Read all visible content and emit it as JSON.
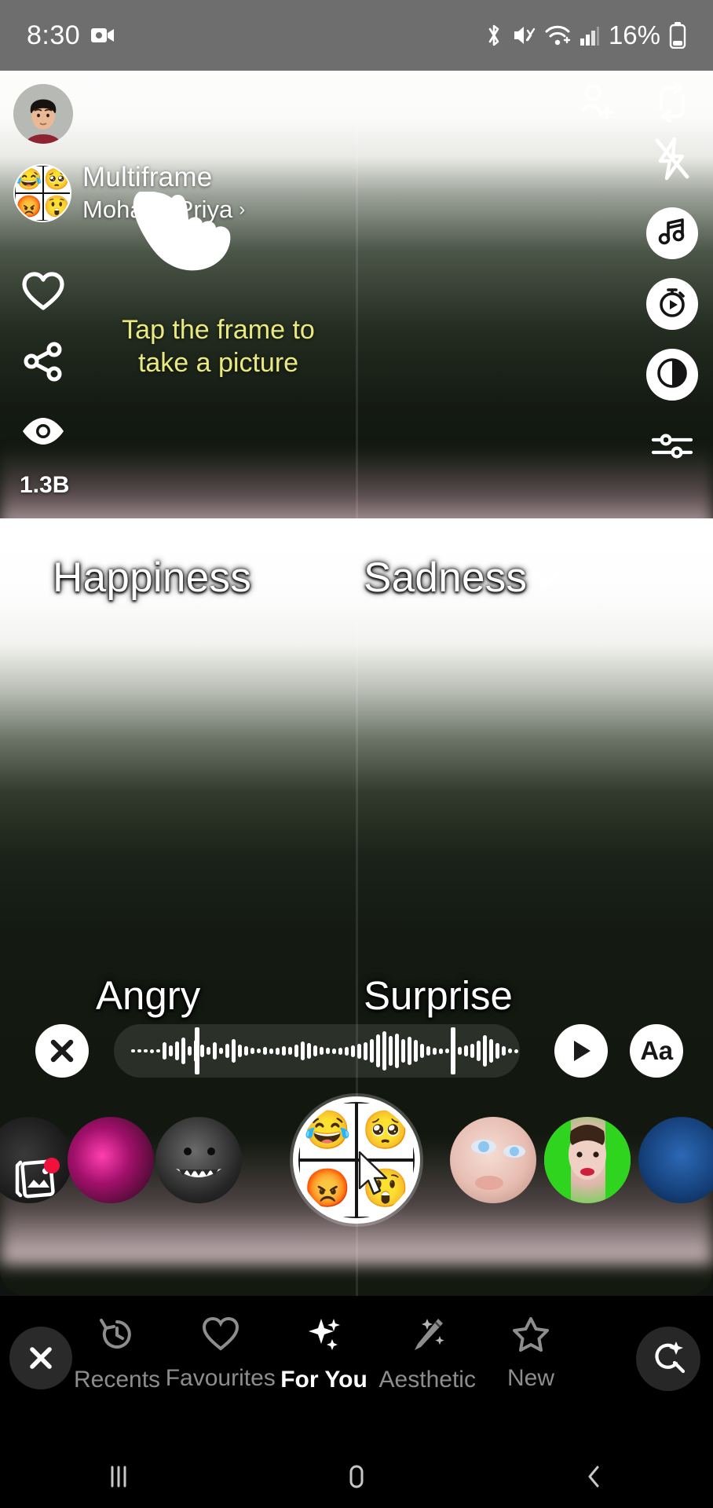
{
  "status_bar": {
    "time": "8:30",
    "battery_percent": "16%",
    "icons": [
      "screen-record-icon",
      "bluetooth-icon",
      "mute-icon",
      "wifi-icon",
      "cellular-signal-icon",
      "battery-icon"
    ]
  },
  "lens": {
    "title": "Multiframe",
    "author": "Mohana Priya",
    "author_chevron": "›",
    "quad_emojis": [
      "😂",
      "🥺",
      "😡",
      "😲"
    ],
    "favorite_count": "1.3B",
    "hint_line1": "Tap the frame to",
    "hint_line2": "take a picture",
    "hint_color": "#e9e97f"
  },
  "left_rail": [
    {
      "name": "heart-icon",
      "label": "Favourite"
    },
    {
      "name": "share-icon",
      "label": "Share"
    },
    {
      "name": "eye-icon",
      "label": "Preview"
    }
  ],
  "right_rail": [
    {
      "name": "add-person-icon",
      "label": "Add friend"
    },
    {
      "name": "flip-camera-icon",
      "label": "Flip camera"
    },
    {
      "name": "flash-off-icon",
      "label": "Flash off"
    },
    {
      "name": "music-icon",
      "label": "Music"
    },
    {
      "name": "timer-icon",
      "label": "Timer"
    },
    {
      "name": "contrast-icon",
      "label": "Contrast"
    },
    {
      "name": "adjust-sliders-icon",
      "label": "Adjust"
    }
  ],
  "frames": {
    "top_left_label": "Happiness",
    "top_right_label": "Sadness",
    "top_right_chevron": "⌄",
    "bottom_left_label": "Angry",
    "bottom_right_label": "Surprise"
  },
  "audio_bar": {
    "close_label": "✕",
    "play_label": "▶",
    "text_label": "Aa",
    "waveform": [
      3,
      4,
      4,
      5,
      3,
      22,
      14,
      24,
      34,
      12,
      28,
      16,
      10,
      22,
      8,
      18,
      30,
      16,
      12,
      8,
      6,
      10,
      7,
      9,
      12,
      10,
      16,
      24,
      20,
      14,
      10,
      8,
      7,
      9,
      11,
      15,
      19,
      23,
      30,
      42,
      50,
      38,
      44,
      30,
      36,
      28,
      18,
      12,
      9,
      7,
      6,
      8,
      10,
      14,
      18,
      26,
      40,
      30,
      20,
      12,
      6,
      5,
      4,
      5,
      4,
      3
    ],
    "trim_start_pct": 20,
    "trim_end_pct": 83
  },
  "carousel": {
    "selected_index": 3,
    "selected_quad_emojis": [
      "😂",
      "🥺",
      "😡",
      "😲"
    ],
    "gallery_icon": "gallery-icon",
    "gallery_badge": true
  },
  "bottom_nav": {
    "close_label": "✕",
    "tabs": [
      {
        "label": "Recents",
        "icon": "history-icon",
        "active": false
      },
      {
        "label": "Favourites",
        "icon": "heart-icon",
        "active": false
      },
      {
        "label": "For You",
        "icon": "sparkles-icon",
        "active": true
      },
      {
        "label": "Aesthetic",
        "icon": "magic-wand-icon",
        "active": false
      },
      {
        "label": "New",
        "icon": "star-icon",
        "active": false
      }
    ],
    "explore_icon": "explore-search-icon"
  },
  "android_nav": {
    "recents": "recents-nav-icon",
    "home": "home-nav-icon",
    "back": "back-nav-icon"
  },
  "colors": {
    "hint_yellow": "#e9e97f",
    "status_bar_bg": "#6e6e6e",
    "nav_bg": "#000000",
    "accent_white": "#ffffff"
  }
}
